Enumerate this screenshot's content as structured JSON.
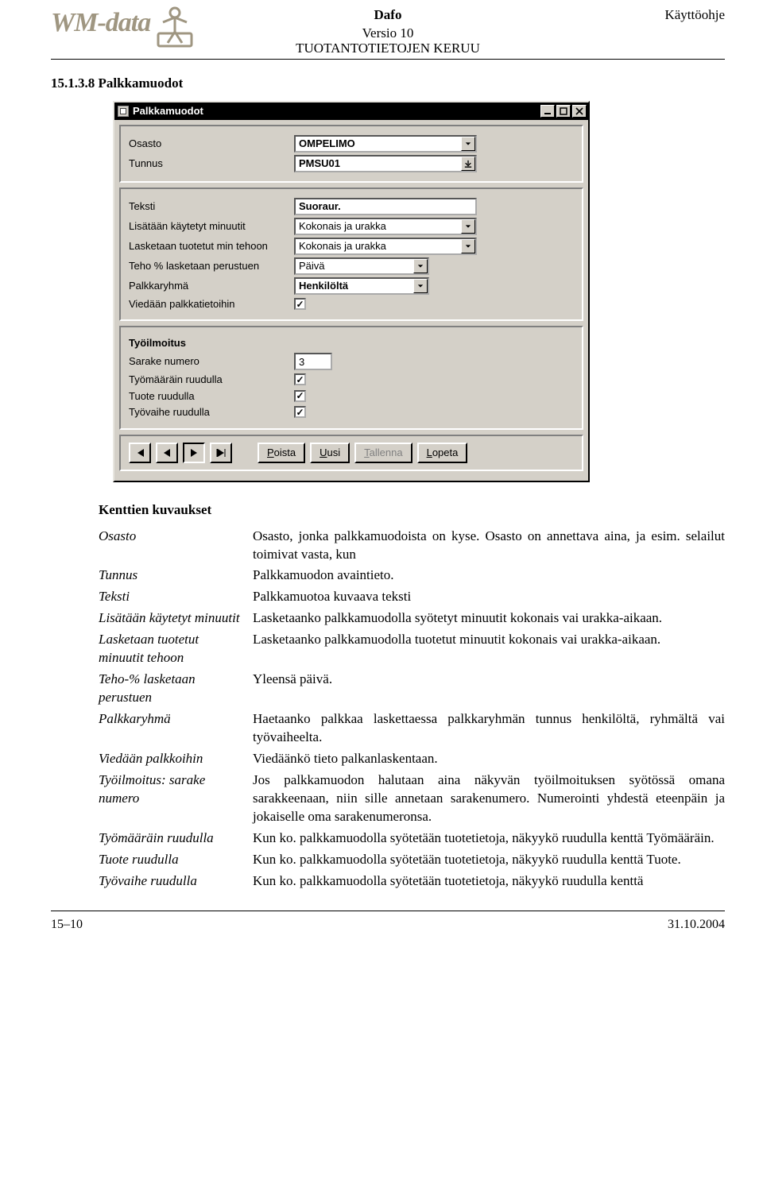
{
  "header": {
    "logo_text": "WM-data",
    "center_title": "Dafo",
    "center_sub": "Versio 10",
    "center_sub2": "TUOTANTOTIETOJEN KERUU",
    "right": "Käyttöohje"
  },
  "section_heading": "15.1.3.8 Palkkamuodot",
  "dialog": {
    "title": "Palkkamuodot",
    "btn_min": "_",
    "btn_max": "□",
    "btn_close": "×",
    "group1": {
      "osasto_label": "Osasto",
      "osasto_value": "OMPELIMO",
      "tunnus_label": "Tunnus",
      "tunnus_value": "PMSU01"
    },
    "group2": {
      "teksti_label": "Teksti",
      "teksti_value": "Suoraur.",
      "lisataan_label": "Lisätään käytetyt minuutit",
      "lisataan_value": "Kokonais ja urakka",
      "lasketaan_label": "Lasketaan tuotetut min tehoon",
      "lasketaan_value": "Kokonais ja urakka",
      "teho_label": "Teho % lasketaan perustuen",
      "teho_value": "Päivä",
      "palkkaryhma_label": "Palkkaryhmä",
      "palkkaryhma_value": "Henkilöltä",
      "viedaan_label": "Viedään palkkatietoihin"
    },
    "group3": {
      "heading": "Työilmoitus",
      "sarake_label": "Sarake numero",
      "sarake_value": "3",
      "tyomaar_label": "Työmääräin ruudulla",
      "tuote_label": "Tuote ruudulla",
      "tyovaihe_label": "Työvaihe ruudulla"
    },
    "nav": {
      "first": "|<",
      "prev": "<",
      "next": ">",
      "last": ">|",
      "poista": "Poista",
      "poista_u": "P",
      "uusi": "Uusi",
      "uusi_u": "U",
      "tallenna": "Tallenna",
      "tallenna_u": "T",
      "lopeta": "Lopeta",
      "lopeta_u": "L"
    }
  },
  "descriptions_heading": "Kenttien kuvaukset",
  "descriptions": [
    {
      "term": "Osasto",
      "def": "Osasto, jonka palkkamuodoista on kyse. Osasto on annettava aina, ja esim. selailut toimivat vasta, kun"
    },
    {
      "term": "Tunnus",
      "def": "Palkkamuodon avaintieto."
    },
    {
      "term": "Teksti",
      "def": "Palkkamuotoa kuvaava teksti"
    },
    {
      "term": "Lisätään käytetyt minuutit",
      "def": "Lasketaanko palkkamuodolla syötetyt minuutit kokonais vai urakka-aikaan."
    },
    {
      "term": "Lasketaan tuotetut minuutit tehoon",
      "def": "Lasketaanko palkkamuodolla tuotetut minuutit kokonais vai urakka-aikaan."
    },
    {
      "term": "Teho-% lasketaan perustuen",
      "def": "Yleensä päivä."
    },
    {
      "term": "Palkkaryhmä",
      "def": "Haetaanko palkkaa laskettaessa palkkaryhmän tunnus henkilöltä, ryhmältä vai työvaiheelta."
    },
    {
      "term": "Viedään palkkoihin",
      "def": "Viedäänkö tieto palkanlaskentaan."
    },
    {
      "term": "Työilmoitus: sarake numero",
      "def": "Jos palkkamuodon halutaan aina näkyvän työilmoituksen syötössä omana sarakkeenaan, niin sille annetaan sarakenumero. Numerointi yhdestä eteenpäin ja jokaiselle oma sarakenumeronsa."
    },
    {
      "term": "Työmääräin ruudulla",
      "def": "Kun ko. palkkamuodolla syötetään tuotetietoja, näkyykö ruudulla kenttä Työmääräin."
    },
    {
      "term": "Tuote ruudulla",
      "def": "Kun ko. palkkamuodolla syötetään tuotetietoja, näkyykö ruudulla kenttä Tuote."
    },
    {
      "term": "Työvaihe ruudulla",
      "def": "Kun ko. palkkamuodolla syötetään tuotetietoja, näkyykö ruudulla kenttä"
    }
  ],
  "footer": {
    "left": "15–10",
    "right": "31.10.2004"
  }
}
